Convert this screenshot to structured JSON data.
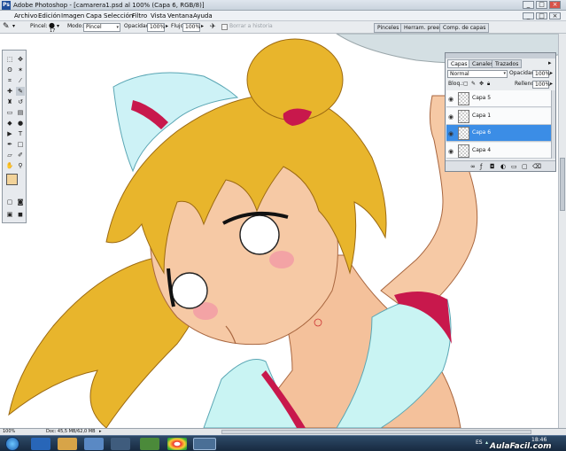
{
  "window": {
    "app_badge": "Ps",
    "title": "Adobe Photoshop - [camarera1.psd al 100% (Capa 6, RGB/8)]",
    "controls": [
      "_",
      "□",
      "×"
    ],
    "doc_controls": [
      "_",
      "□",
      "×"
    ]
  },
  "menu": [
    "Archivo",
    "Edición",
    "Imagen",
    "Capa",
    "Selección",
    "Filtro",
    "Vista",
    "Ventana",
    "Ayuda"
  ],
  "options": {
    "brush_label": "Pincel:",
    "brush_size": "17",
    "mode_label": "Modo:",
    "mode_value": "Pincel",
    "opacity_label": "Opacidad:",
    "opacity_value": "100%",
    "flow_label": "Flujo:",
    "flow_value": "100%",
    "history_label": "Borrar a historia",
    "right_tabs": [
      "Pinceles",
      "Herram. preest.",
      "Comp. de capas"
    ]
  },
  "layers_panel": {
    "tabs": [
      "Capas",
      "Canales",
      "Trazados"
    ],
    "blend_mode": "Normal",
    "opacity_label": "Opacidad:",
    "opacity_value": "100%",
    "lock_label": "Bloq.:",
    "fill_label": "Relleno:",
    "fill_value": "100%",
    "layers": [
      {
        "name": "Capa 5",
        "selected": false
      },
      {
        "name": "Capa 1",
        "selected": false
      },
      {
        "name": "Capa 6",
        "selected": true
      },
      {
        "name": "Capa 4",
        "selected": false
      }
    ],
    "bottom_icons": [
      "link-icon",
      "fx-icon",
      "mask-icon",
      "adjustment-icon",
      "folder-icon",
      "new-layer-icon",
      "trash-icon"
    ]
  },
  "status": {
    "zoom": "100%",
    "doc_info": "Doc: 45,5 MB/62,0 MB"
  },
  "taskbar": {
    "language": "ES",
    "time": "18:46",
    "watermark": "AulaFacil.com"
  },
  "colors": {
    "title_bar": "#c9d3dd",
    "selection": "#3b8de6",
    "hair": "#e8b52c",
    "skin": "#f6c9a5",
    "uniform": "#c9f4f3",
    "stripe": "#c8184c",
    "taskbar": "#1e3552"
  }
}
